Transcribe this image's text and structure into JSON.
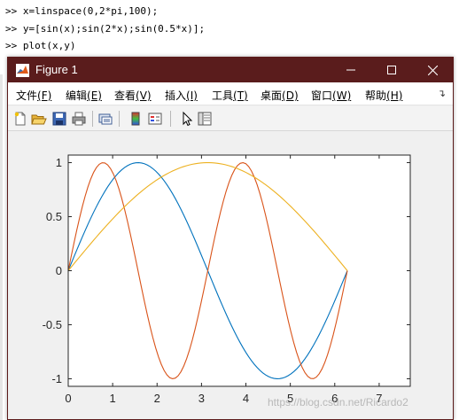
{
  "console": {
    "lines": [
      ">> x=linspace(0,2*pi,100);",
      ">> y=[sin(x);sin(2*x);sin(0.5*x)];",
      ">> plot(x,y)"
    ]
  },
  "figure": {
    "title": "Figure 1",
    "menu": [
      {
        "label": "文件",
        "accel": "(F)"
      },
      {
        "label": "编辑",
        "accel": "(E)"
      },
      {
        "label": "查看",
        "accel": "(V)"
      },
      {
        "label": "插入",
        "accel": "(I)"
      },
      {
        "label": "工具",
        "accel": "(T)"
      },
      {
        "label": "桌面",
        "accel": "(D)"
      },
      {
        "label": "窗口",
        "accel": "(W)"
      },
      {
        "label": "帮助",
        "accel": "(H)"
      }
    ],
    "toolbar_icons": [
      "new-figure-icon",
      "open-file-icon",
      "save-icon",
      "print-icon",
      "link-plot-icon",
      "insert-colorbar-icon",
      "insert-legend-icon",
      "edit-plot-pointer-icon",
      "property-inspector-icon"
    ]
  },
  "watermark": "https://blog.csdn.net/Ricardo2",
  "colors": {
    "titlebar": "#5a1c1c",
    "series1": "#0072bd",
    "series2": "#d95319",
    "series3": "#edb120"
  },
  "chart_data": {
    "type": "line",
    "title": "",
    "xlabel": "",
    "ylabel": "",
    "xlim": [
      0,
      7.7
    ],
    "ylim": [
      -1.07,
      1.07
    ],
    "xticks": [
      "0",
      "1",
      "2",
      "3",
      "4",
      "5",
      "6",
      "7"
    ],
    "yticks": [
      "1",
      "0.5",
      "0",
      "-0.5",
      "-1"
    ],
    "grid": false,
    "x": {
      "start": 0,
      "end": 6.2832,
      "points": 100
    },
    "series": [
      {
        "function": "sin(x)"
      },
      {
        "function": "sin(2*x)"
      },
      {
        "function": "sin(0.5*x)"
      }
    ]
  }
}
